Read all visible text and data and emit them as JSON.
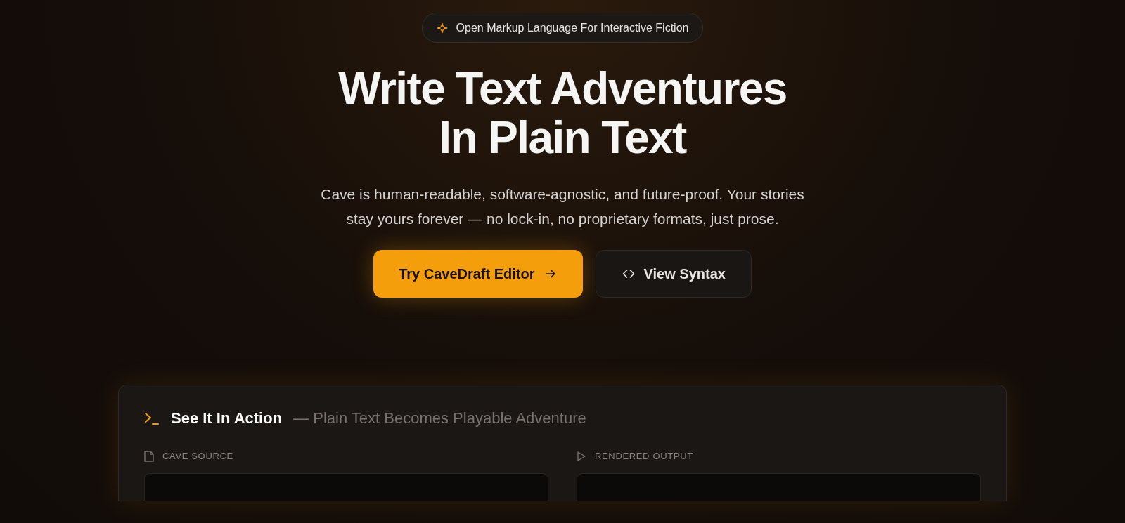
{
  "badge": {
    "text": "Open Markup Language For Interactive Fiction"
  },
  "hero": {
    "title_lines": [
      "Write Text Adventures",
      "In Plain Text"
    ],
    "description": "Cave is human-readable, software-agnostic, and future-proof. Your stories stay yours forever — no lock-in, no proprietary formats, just prose."
  },
  "buttons": [
    {
      "kind": "primary",
      "label": "Try CaveDraft Editor"
    },
    {
      "kind": "secondary",
      "label": "View Syntax"
    }
  ],
  "demo": {
    "title": "See It In Action",
    "subtitle": "— Plain Text Becomes Playable Adventure",
    "panels": [
      {
        "kind": "source",
        "label": "CAVE SOURCE"
      },
      {
        "kind": "output",
        "label": "RENDERED OUTPUT"
      }
    ]
  }
}
